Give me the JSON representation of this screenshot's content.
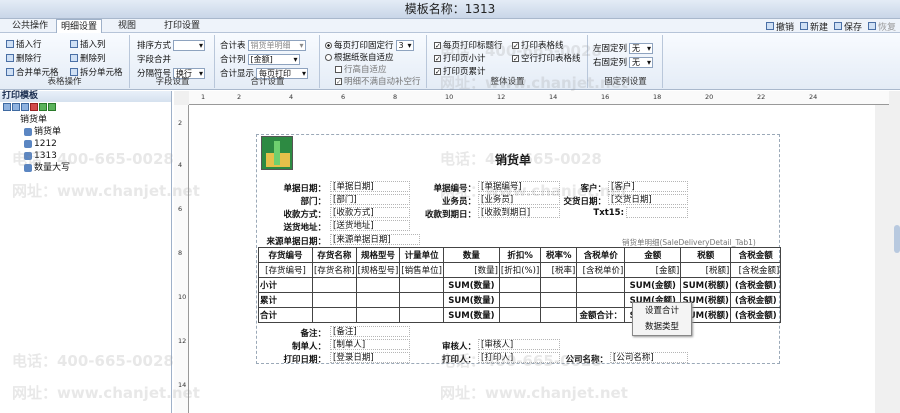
{
  "window": {
    "title": "模板名称：1313"
  },
  "tabs": [
    "公共操作",
    "明细设置",
    "视图",
    "打印设置"
  ],
  "top_buttons": [
    {
      "label": "撤销",
      "icon": "undo-icon",
      "enabled": true
    },
    {
      "label": "新建",
      "icon": "new-icon",
      "enabled": true
    },
    {
      "label": "保存",
      "icon": "save-icon",
      "enabled": true
    },
    {
      "label": "恢复",
      "icon": "restore-icon",
      "enabled": false
    }
  ],
  "ribbon": {
    "table_ops": {
      "label": "表格操作",
      "b1": "插入行",
      "b2": "插入列",
      "b3": "删除行",
      "b4": "删除列",
      "b5": "合并单元格",
      "b6": "拆分单元格"
    },
    "field_setting": {
      "label": "字段设置",
      "sort_label": "排序方式",
      "sort_value": "",
      "merge_label": "字段合并",
      "sep_label": "分隔符号",
      "sep_value": "换行"
    },
    "total_setting": {
      "label": "合计设置",
      "total_table_label": "合计表",
      "total_table_value": "销货单明细",
      "total_col_label": "合计列",
      "total_col_value": "[金额]",
      "total_show_label": "合计显示",
      "total_show_value": "每页打印"
    },
    "page_setting": {
      "opt1": "每页打印固定行",
      "opt1_value": "3",
      "opt2": "根据纸张自适应",
      "opt3": "行高自适应",
      "opt4": "明细不满自动补空行"
    },
    "overall": {
      "label": "整体设置",
      "c1": "每页打印标题行",
      "c2": "打印表格线",
      "c3": "打印页小计",
      "c4": "空行打印表格线",
      "c5": "打印页累计"
    },
    "fixed_col": {
      "label": "固定列设置",
      "left_label": "左固定列",
      "left_value": "无",
      "right_label": "右固定列",
      "right_value": "无"
    }
  },
  "left_panel": {
    "title": "打印模板",
    "tree": {
      "root": "销货单",
      "children": [
        "销货单",
        "1212",
        "1313",
        "数量大写"
      ]
    }
  },
  "ruler": {
    "h": [
      "1",
      "2",
      "4",
      "6",
      "8",
      "10",
      "12",
      "14",
      "16",
      "18",
      "20",
      "22",
      "24"
    ],
    "v": [
      "2",
      "4",
      "6",
      "8",
      "10",
      "12",
      "14"
    ]
  },
  "form": {
    "title": "销货单",
    "header": [
      {
        "label": "单据日期：",
        "value": "[单据日期]"
      },
      {
        "label": "单据编号：",
        "value": "[单据编号]"
      },
      {
        "label": "客户：",
        "value": "[客户]"
      },
      {
        "label": "部门：",
        "value": "[部门]"
      },
      {
        "label": "业务员：",
        "value": "[业务员]"
      },
      {
        "label": "交货日期：",
        "value": "[交货日期]"
      },
      {
        "label": "收款方式：",
        "value": "[收款方式]"
      },
      {
        "label": "收款到期日：",
        "value": "[收款到期日]"
      },
      {
        "label": "Txt15:",
        "value": ""
      },
      {
        "label": "送货地址：",
        "value": "[送货地址]"
      },
      {
        "label": "来源单据日期：",
        "value": "[来源单据日期]"
      }
    ],
    "detail_subtitle": "销货单明细(SaleDeliveryDetail_Tab1)",
    "columns": [
      "存货编号",
      "存货名称",
      "规格型号",
      "计量单位",
      "数量",
      "折扣%",
      "税率%",
      "含税单价",
      "金额",
      "税额",
      "含税金额"
    ],
    "row_values": [
      "[存货编号]",
      "[存货名称]",
      "[规格型号]",
      "[销售单位]",
      "[数量]",
      "[折扣(%)]",
      "[税率]",
      "[含税单价]",
      "[金额]",
      "[税额]",
      "[含税金额]"
    ],
    "sum_qty": "SUM(数量)",
    "sum_amt": "SUM(金额)",
    "sum_tax": "SUM(税额)",
    "sum_tt": "(含税金额)",
    "row_labels": [
      "小计",
      "累计",
      "合计"
    ],
    "amount_total_label": "金额合计：",
    "footer": [
      {
        "label": "备注：",
        "value": "[备注]"
      },
      {
        "label": "制单人：",
        "value": "[制单人]"
      },
      {
        "label": "审核人：",
        "value": "[审核人]"
      },
      {
        "label": "打印日期：",
        "value": "[登录日期]"
      },
      {
        "label": "打印人：",
        "value": "[打印人]"
      },
      {
        "label": "公司名称：",
        "value": "[公司名称]"
      }
    ]
  },
  "context_menu": [
    "设置合计",
    "数据类型"
  ],
  "watermarks": [
    "电话：400-665-0028",
    "网址：www.chanjet.net"
  ]
}
